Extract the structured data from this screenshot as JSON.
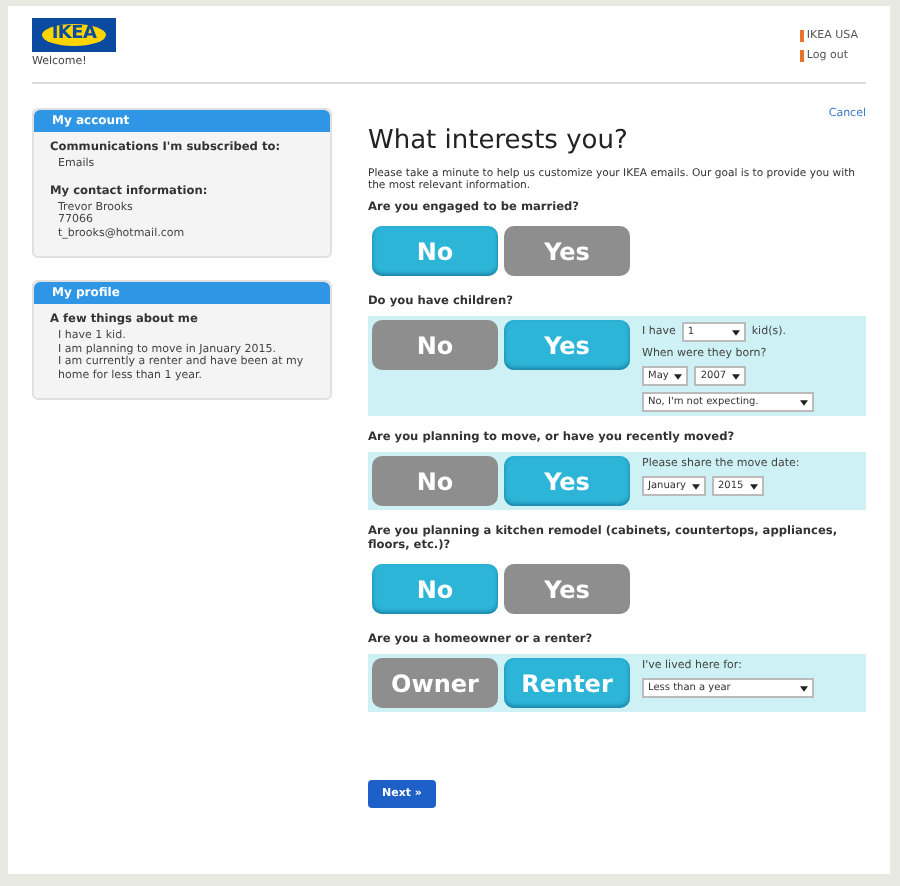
{
  "header": {
    "logo": "IKEA",
    "welcome": "Welcome!",
    "links": [
      "IKEA USA",
      "Log out"
    ]
  },
  "sidebar": [
    {
      "title": "My account",
      "sections": [
        {
          "heading": "Communications I'm subscribed to:",
          "lines": [
            "Emails"
          ]
        },
        {
          "heading": "My contact information:",
          "lines": [
            "Trevor Brooks",
            "77066",
            "t_brooks@hotmail.com"
          ]
        }
      ]
    },
    {
      "title": "My profile",
      "sections": [
        {
          "heading": "A few things about me",
          "lines": [
            "I have 1 kid.",
            "I am planning to move in January 2015.",
            "I am currently a renter and have been at my home for less than 1 year."
          ]
        }
      ]
    }
  ],
  "cancel": "Cancel",
  "title": "What interests you?",
  "intro": "Please take a minute to help us customize your IKEA emails. Our goal is to provide you with the most relevant information.",
  "questions": [
    {
      "label": "Are you engaged to be married?",
      "options": [
        {
          "label": "No",
          "selected": true
        },
        {
          "label": "Yes",
          "selected": false
        }
      ]
    },
    {
      "label": "Do you have children?",
      "options": [
        {
          "label": "No",
          "selected": false
        },
        {
          "label": "Yes",
          "selected": true
        }
      ],
      "details": [
        [
          {
            "kind": "text",
            "text": "I have"
          },
          {
            "kind": "select",
            "value": "1"
          },
          {
            "kind": "text",
            "text": "kid(s)."
          }
        ],
        [
          {
            "kind": "text",
            "text": "When were they born?"
          }
        ],
        [
          {
            "kind": "select",
            "value": "May"
          },
          {
            "kind": "select",
            "value": "2007"
          }
        ],
        [
          {
            "kind": "select",
            "value": "No, I'm not expecting."
          }
        ]
      ]
    },
    {
      "label": "Are you planning to move, or have you recently moved?",
      "options": [
        {
          "label": "No",
          "selected": false
        },
        {
          "label": "Yes",
          "selected": true
        }
      ],
      "details": [
        [
          {
            "kind": "text",
            "text": "Please share the move date:"
          }
        ],
        [
          {
            "kind": "select",
            "value": "January"
          },
          {
            "kind": "select",
            "value": "2015"
          }
        ]
      ]
    },
    {
      "label": "Are you planning a kitchen remodel (cabinets, countertops, appliances, floors, etc.)?",
      "options": [
        {
          "label": "No",
          "selected": true
        },
        {
          "label": "Yes",
          "selected": false
        }
      ]
    },
    {
      "label": "Are you a homeowner or a renter?",
      "options": [
        {
          "label": "Owner",
          "selected": false
        },
        {
          "label": "Renter",
          "selected": true
        }
      ],
      "details": [
        [
          {
            "kind": "text",
            "text": "I've lived here for:"
          }
        ],
        [
          {
            "kind": "select",
            "value": "Less than a year"
          }
        ]
      ]
    }
  ],
  "next": "Next »"
}
